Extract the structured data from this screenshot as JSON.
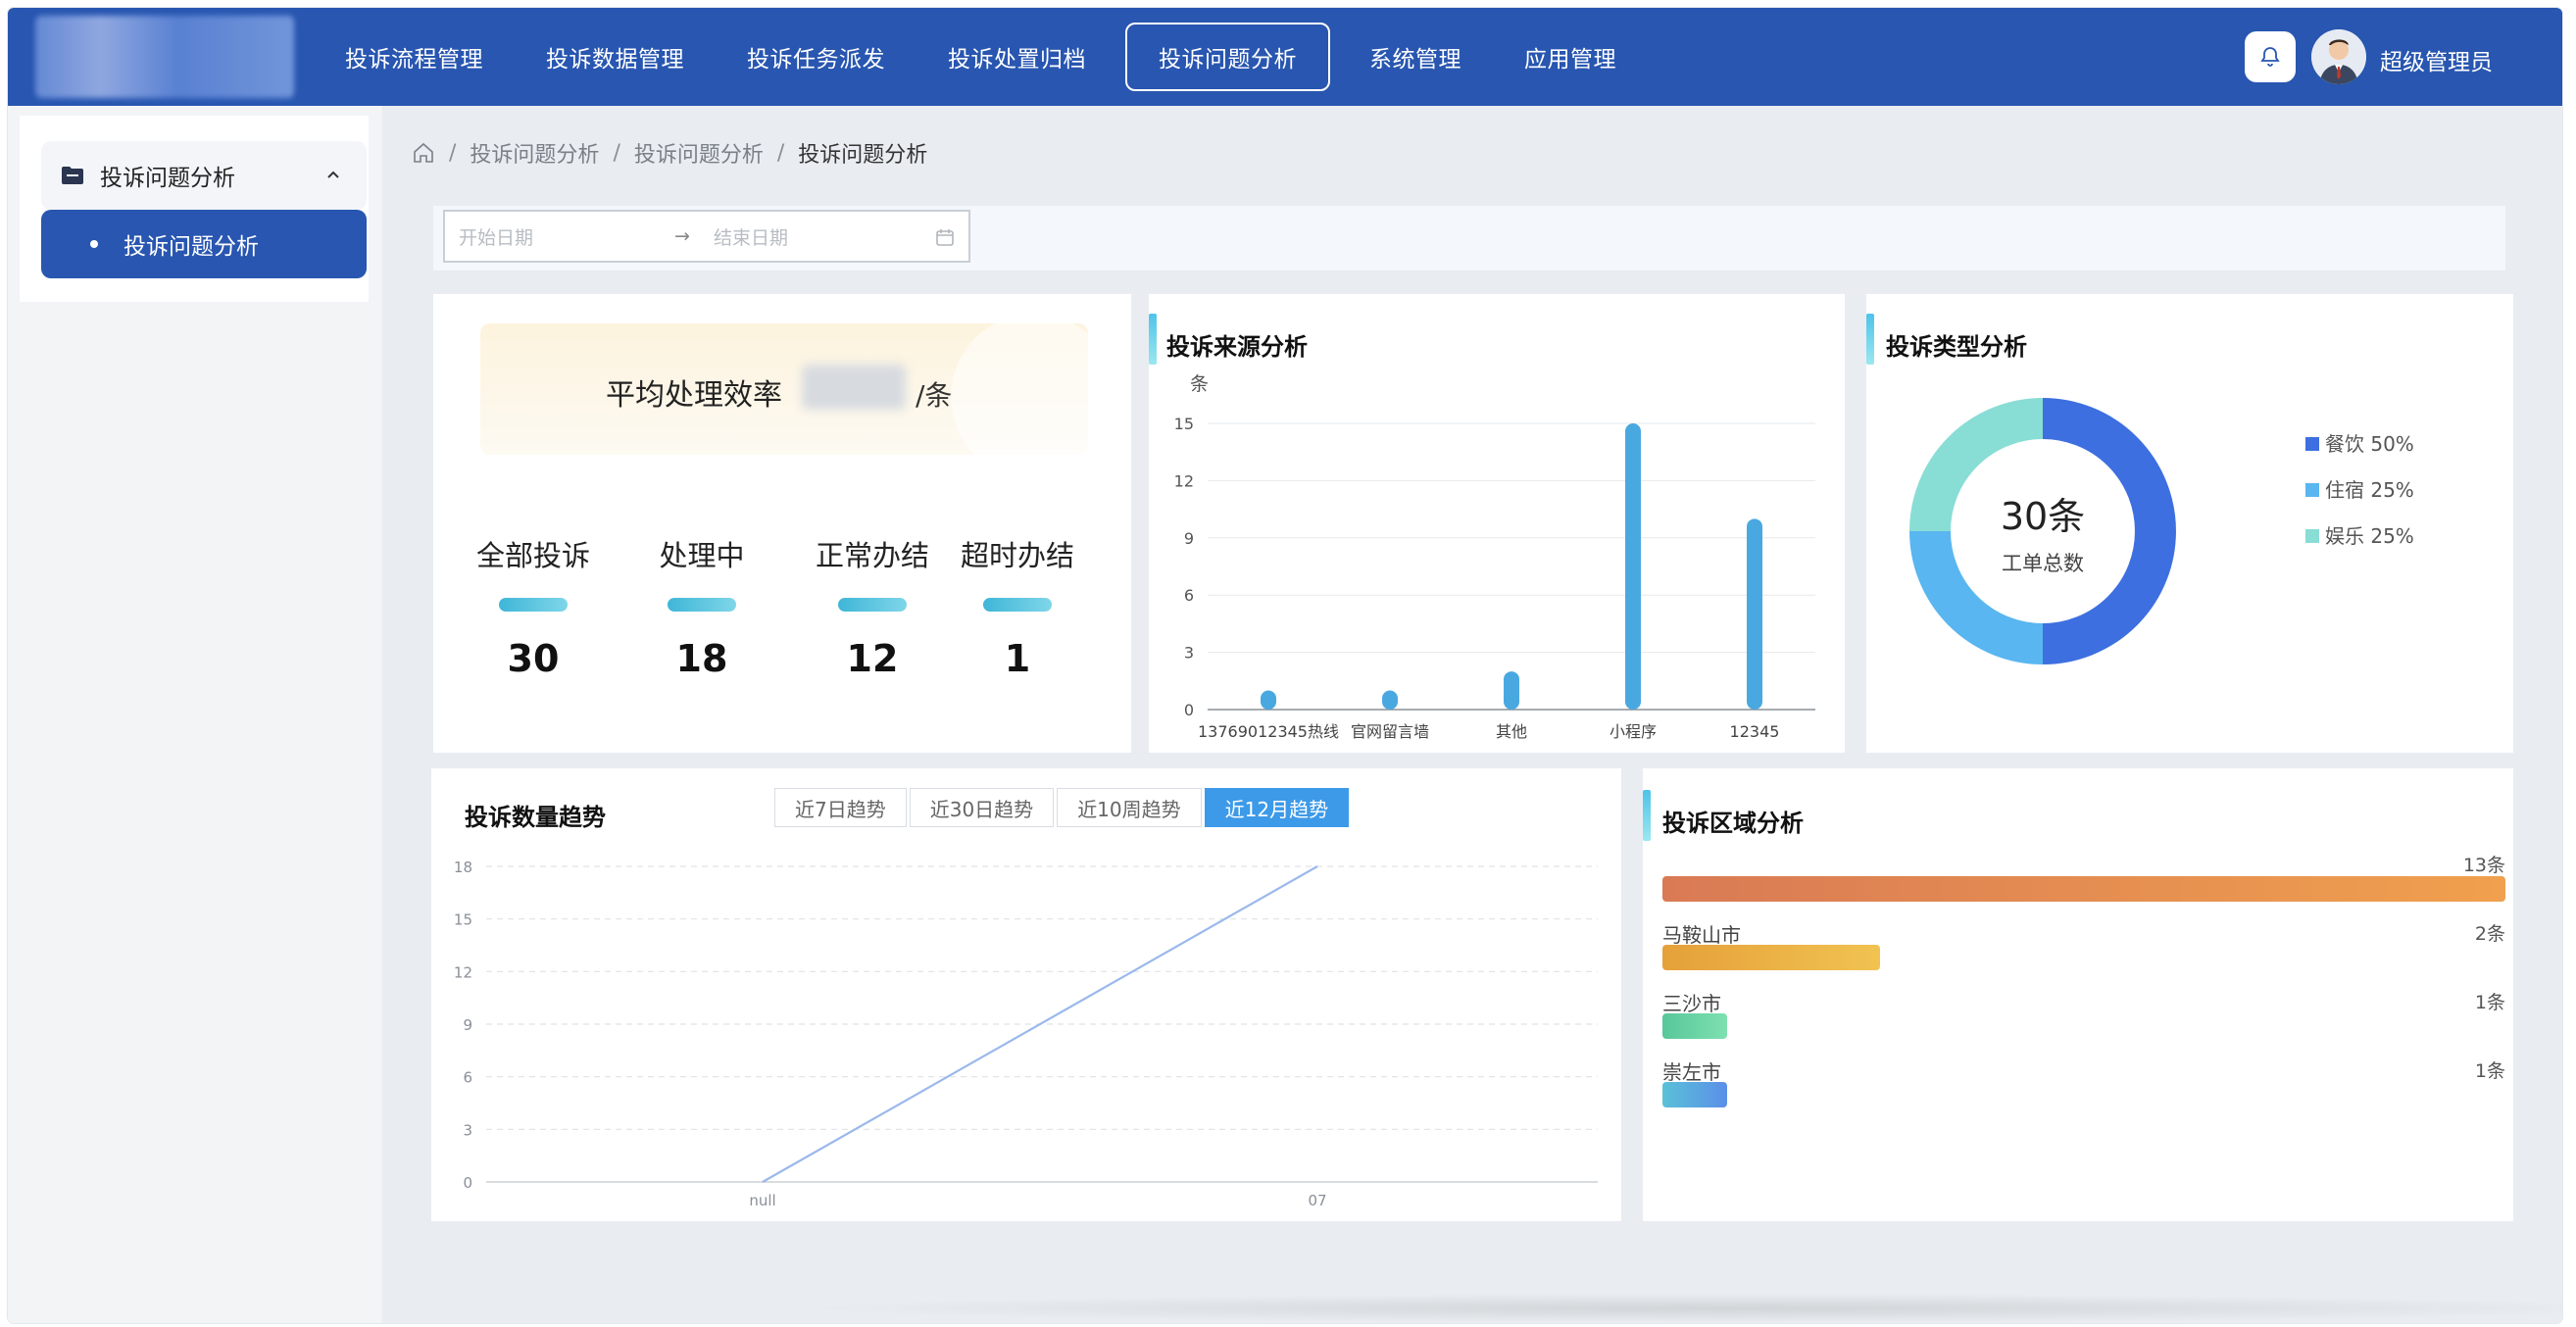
{
  "header": {
    "nav": [
      "投诉流程管理",
      "投诉数据管理",
      "投诉任务派发",
      "投诉处置归档",
      "投诉问题分析",
      "系统管理",
      "应用管理"
    ],
    "active_index": 4,
    "username": "超级管理员"
  },
  "sidebar": {
    "group_label": "投诉问题分析",
    "item_label": "投诉问题分析"
  },
  "breadcrumb": [
    "投诉问题分析",
    "投诉问题分析",
    "投诉问题分析"
  ],
  "filter": {
    "start_placeholder": "开始日期",
    "arrow": "→",
    "end_placeholder": "结束日期"
  },
  "efficiency": {
    "label": "平均处理效率",
    "value": "",
    "unit": "/条"
  },
  "stats": [
    {
      "label": "全部投诉",
      "value": "30"
    },
    {
      "label": "处理中",
      "value": "18"
    },
    {
      "label": "正常办结",
      "value": "12"
    },
    {
      "label": "超时办结",
      "value": "1"
    }
  ],
  "source_chart": {
    "title": "投诉来源分析",
    "chart_data": {
      "type": "bar",
      "ylabel": "条",
      "categories": [
        "13769012345热线",
        "官网留言墙",
        "其他",
        "小程序",
        "12345"
      ],
      "values": [
        1,
        1,
        2,
        15,
        10
      ],
      "yticks": [
        0,
        3,
        6,
        9,
        12,
        15
      ],
      "ylim": [
        0,
        15
      ],
      "grid": true,
      "color": "#4aa8e0"
    }
  },
  "type_chart": {
    "title": "投诉类型分析",
    "center_value": "30条",
    "center_label": "工单总数",
    "chart_data": {
      "type": "pie",
      "donut": true,
      "categories": [
        "餐饮",
        "住宿",
        "娱乐"
      ],
      "values": [
        50,
        25,
        25
      ],
      "legend": [
        "餐饮 50%",
        "住宿 25%",
        "娱乐 25%"
      ],
      "colors": [
        "#3d6fe0",
        "#5ab6f0",
        "#88ddd5"
      ],
      "legend_position": "right"
    }
  },
  "trend_chart": {
    "title": "投诉数量趋势",
    "tabs": [
      "近7日趋势",
      "近30日趋势",
      "近10周趋势",
      "近12月趋势"
    ],
    "active_tab": 3,
    "chart_data": {
      "type": "line",
      "x": [
        "null",
        "07"
      ],
      "values": [
        0,
        18
      ],
      "yticks": [
        0,
        3,
        6,
        9,
        12,
        15,
        18
      ],
      "ylim": [
        0,
        18
      ],
      "grid": true,
      "color": "#9ab8ec"
    }
  },
  "region_chart": {
    "title": "投诉区域分析",
    "chart_data": {
      "type": "bar",
      "orientation": "horizontal",
      "rows": [
        {
          "name": "",
          "value": 13,
          "label": "13条",
          "colors": [
            "#d97a55",
            "#f0a04e"
          ]
        },
        {
          "name": "马鞍山市",
          "value": 2,
          "label": "2条",
          "colors": [
            "#e5a03a",
            "#f1c351"
          ]
        },
        {
          "name": "三沙市",
          "value": 1,
          "label": "1条",
          "colors": [
            "#58c79a",
            "#7de0b0"
          ]
        },
        {
          "name": "崇左市",
          "value": 1,
          "label": "1条",
          "colors": [
            "#5ac1d8",
            "#5b8fe8"
          ]
        }
      ],
      "max": 13
    }
  }
}
